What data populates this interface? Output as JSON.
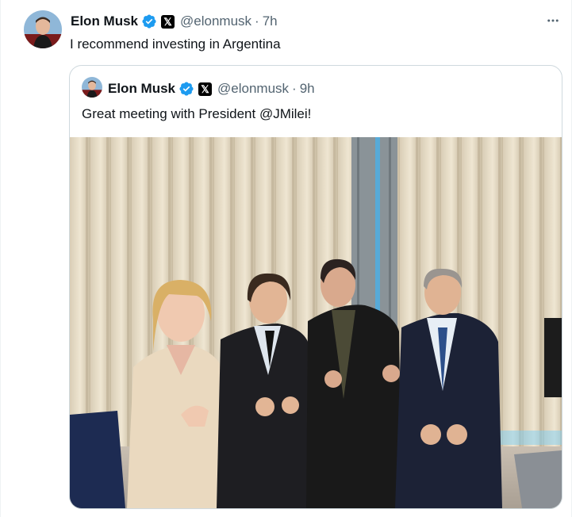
{
  "tweet": {
    "author_name": "Elon Musk",
    "handle": "@elonmusk",
    "separator": "·",
    "time": "7h",
    "text": "I recommend investing in Argentina",
    "more_icon": "ellipsis-icon"
  },
  "quoted_tweet": {
    "author_name": "Elon Musk",
    "handle": "@elonmusk",
    "separator": "·",
    "time": "9h",
    "text": "Great meeting with President @JMilei!"
  },
  "badges": {
    "verified_color": "#1d9bf0",
    "affiliate_icon": "x-logo-icon",
    "affiliate_glyph": "𝕏"
  }
}
